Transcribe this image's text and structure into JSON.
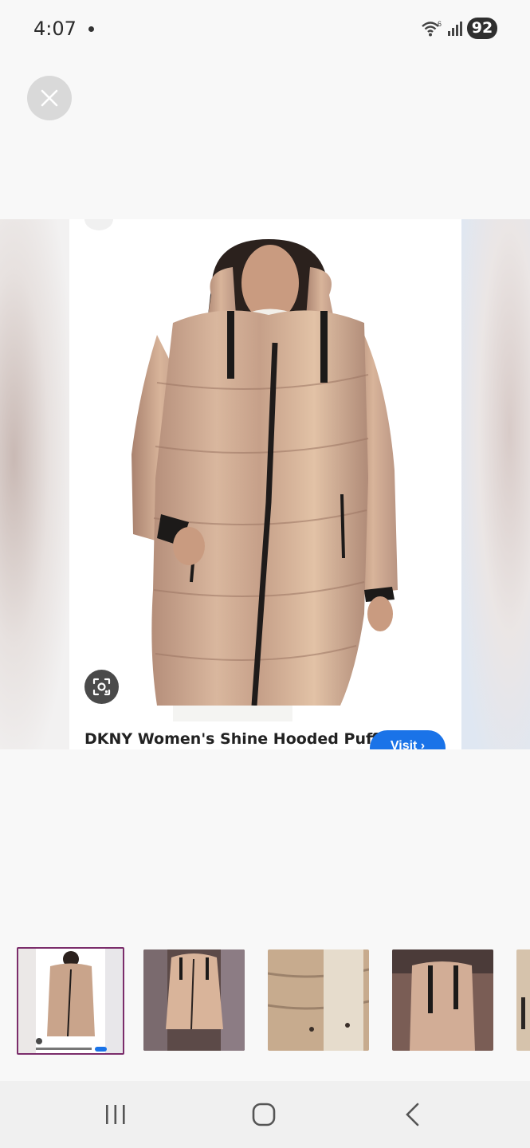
{
  "status_bar": {
    "time": "4:07",
    "battery": "92",
    "wifi_badge": "6"
  },
  "icons": {
    "close": "close-icon",
    "lens": "lens-icon",
    "visit_chevron": "chevron-right-icon",
    "nav_recents": "recents-icon",
    "nav_home": "home-icon",
    "nav_back": "back-icon"
  },
  "product": {
    "title": "DKNY Women's Shine Hooded Puffer",
    "visit_label": "Visit ›"
  },
  "thumbnails": [
    {
      "label": "thumbnail-1",
      "selected": true
    },
    {
      "label": "thumbnail-2",
      "selected": false
    },
    {
      "label": "thumbnail-3",
      "selected": false
    },
    {
      "label": "thumbnail-4",
      "selected": false
    },
    {
      "label": "thumbnail-5",
      "selected": false
    }
  ],
  "colors": {
    "accent_blue": "#1a73e8",
    "selected_border": "#7b2d6b",
    "coat_rose_gold": "#c9a48b"
  }
}
